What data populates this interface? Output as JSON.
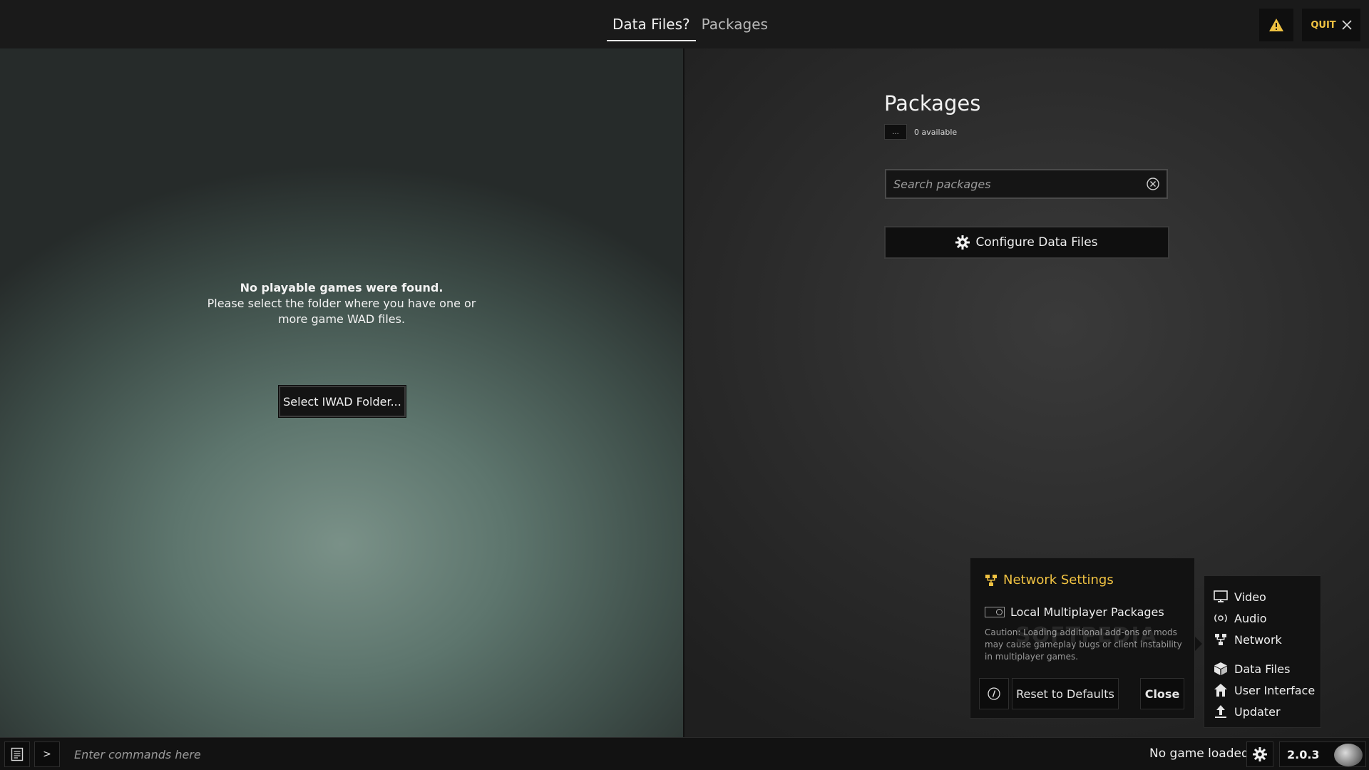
{
  "tabs": [
    "Data Files?",
    "Packages"
  ],
  "header": {
    "quit_label": "QUIT"
  },
  "left": {
    "heading": "No playable games were found.",
    "message": "Please select the folder where you have one or more game WAD files.",
    "select_button": "Select IWAD Folder..."
  },
  "packages": {
    "title": "Packages",
    "menu_label": "...",
    "count": "0 available",
    "search_placeholder": "Search packages",
    "configure_button": "Configure Data Files"
  },
  "network": {
    "title": "Network Settings",
    "option_label": "Local Multiplayer Packages",
    "caution": "Caution: Loading additional add-ons or mods may cause gameplay bugs or client instability in multiplayer games.",
    "reset_label": "Reset to Defaults",
    "close_label": "Close"
  },
  "settings_menu": {
    "items": [
      {
        "label": "Video",
        "icon": "monitor-icon"
      },
      {
        "label": "Audio",
        "icon": "audio-icon"
      },
      {
        "label": "Network",
        "icon": "network-icon"
      },
      {
        "label": "Data Files",
        "icon": "cube-icon"
      },
      {
        "label": "User Interface",
        "icon": "home-icon"
      },
      {
        "label": "Updater",
        "icon": "upload-icon"
      }
    ]
  },
  "bottom": {
    "prompt": ">",
    "command_placeholder": "Enter commands here",
    "status": "No game loaded",
    "version": "2.0.3"
  },
  "watermark": "SOFTPEDIA",
  "colors": {
    "accent": "#f0c242"
  }
}
